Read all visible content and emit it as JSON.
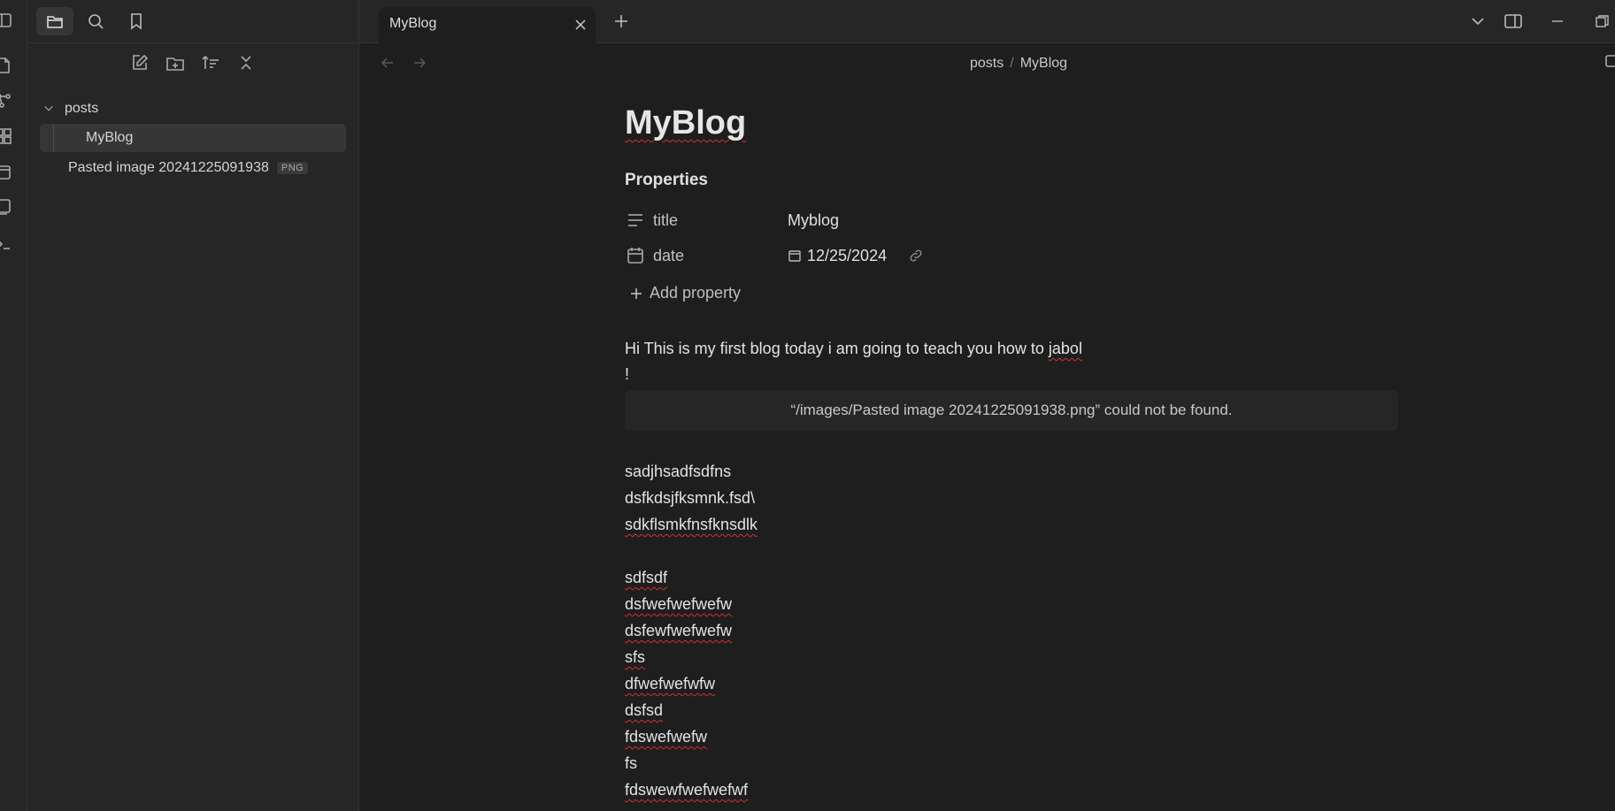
{
  "ribbon": {
    "icons": [
      "open-quick-switcher-icon",
      "graph-view-icon",
      "canvas-icon",
      "daily-note-icon",
      "templates-icon",
      "command-palette-icon"
    ]
  },
  "sidebar": {
    "top_buttons": [
      "sidebar-toggle-icon",
      "files-icon",
      "search-icon",
      "bookmark-icon"
    ],
    "nav_buttons": [
      "new-note-icon",
      "new-folder-icon",
      "sort-icon",
      "collapse-all-icon"
    ],
    "tree": {
      "folder": "posts",
      "files": [
        {
          "name": "MyBlog",
          "selected": true
        },
        {
          "name": "Pasted image 20241225091938",
          "badge": "PNG"
        }
      ]
    }
  },
  "tabs": {
    "active_title": "MyBlog"
  },
  "breadcrumb": {
    "parent": "posts",
    "separator": "/",
    "current": "MyBlog"
  },
  "note": {
    "title": "MyBlog",
    "properties_heading": "Properties",
    "properties": [
      {
        "key": "title",
        "value": "Myblog",
        "icon": "text-lines-icon"
      },
      {
        "key": "date",
        "value": "12/25/2024",
        "icon": "calendar-icon"
      }
    ],
    "add_property": "Add property",
    "intro_line": "Hi This is my first blog today i am going to teach you how to",
    "intro_word": "jabol",
    "bang": "!",
    "embed_error": "“/images/Pasted image 20241225091938.png” could not be found.",
    "lines": [
      "sadjhsadfsdfns",
      "dsfkdsjfksmnk.fsd\\",
      "sdkflsmkfnsfknsdlk",
      "",
      "sdfsdf",
      "dsfwefwefwefw",
      "dsfewfwefwefw",
      "sfs",
      "dfwefwefwfw",
      "dsfsd",
      "fdswefwefw",
      "fs",
      "fdswewfwefwefwf"
    ]
  },
  "colors": {
    "background": "#1e1e1e",
    "sidebar": "#262626",
    "spellcheck": "#d23030"
  }
}
